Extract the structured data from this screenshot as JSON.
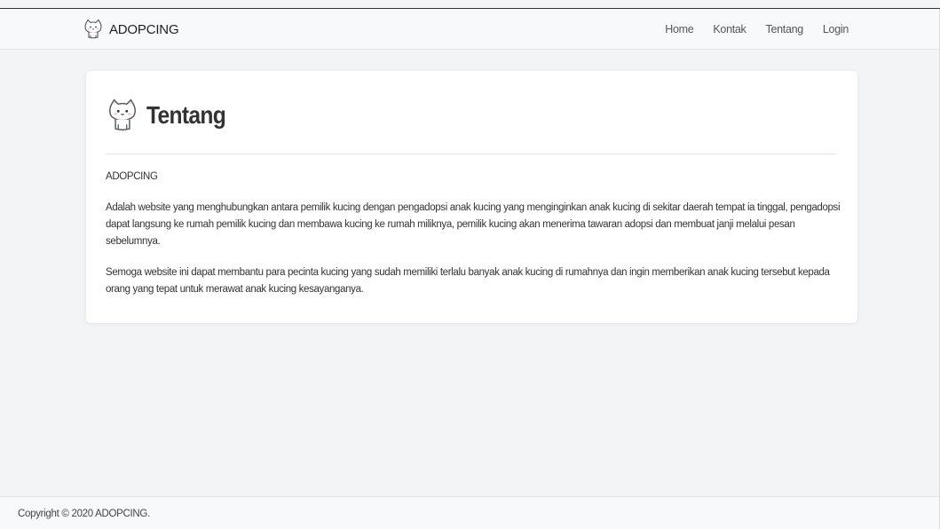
{
  "navbar": {
    "brand": "ADOPCING",
    "links": [
      "Home",
      "Kontak",
      "Tentang",
      "Login"
    ]
  },
  "card": {
    "title": "Tentang",
    "brand_line": "ADOPCING",
    "paragraphs": [
      "Adalah website yang menghubungkan antara pemilik kucing dengan pengadopsi anak kucing yang menginginkan anak kucing di sekitar daerah tempat ia tinggal, pengadopsi dapat langsung ke rumah pemilik kucing dan membawa kucing ke rumah miliknya,  pemilik kucing akan menerima tawaran adopsi dan membuat janji melalui pesan sebelumnya.",
      "Semoga website ini dapat membantu para pecinta kucing yang sudah memiliki terlalu banyak anak kucing di rumahnya dan ingin memberikan anak kucing tersebut kepada orang yang tepat untuk merawat anak kucing kesayanganya."
    ]
  },
  "footer": {
    "copyright": "Copyright © 2020 ADOPCING."
  },
  "icons": {
    "brand": "cat-icon",
    "title": "cat-icon"
  }
}
